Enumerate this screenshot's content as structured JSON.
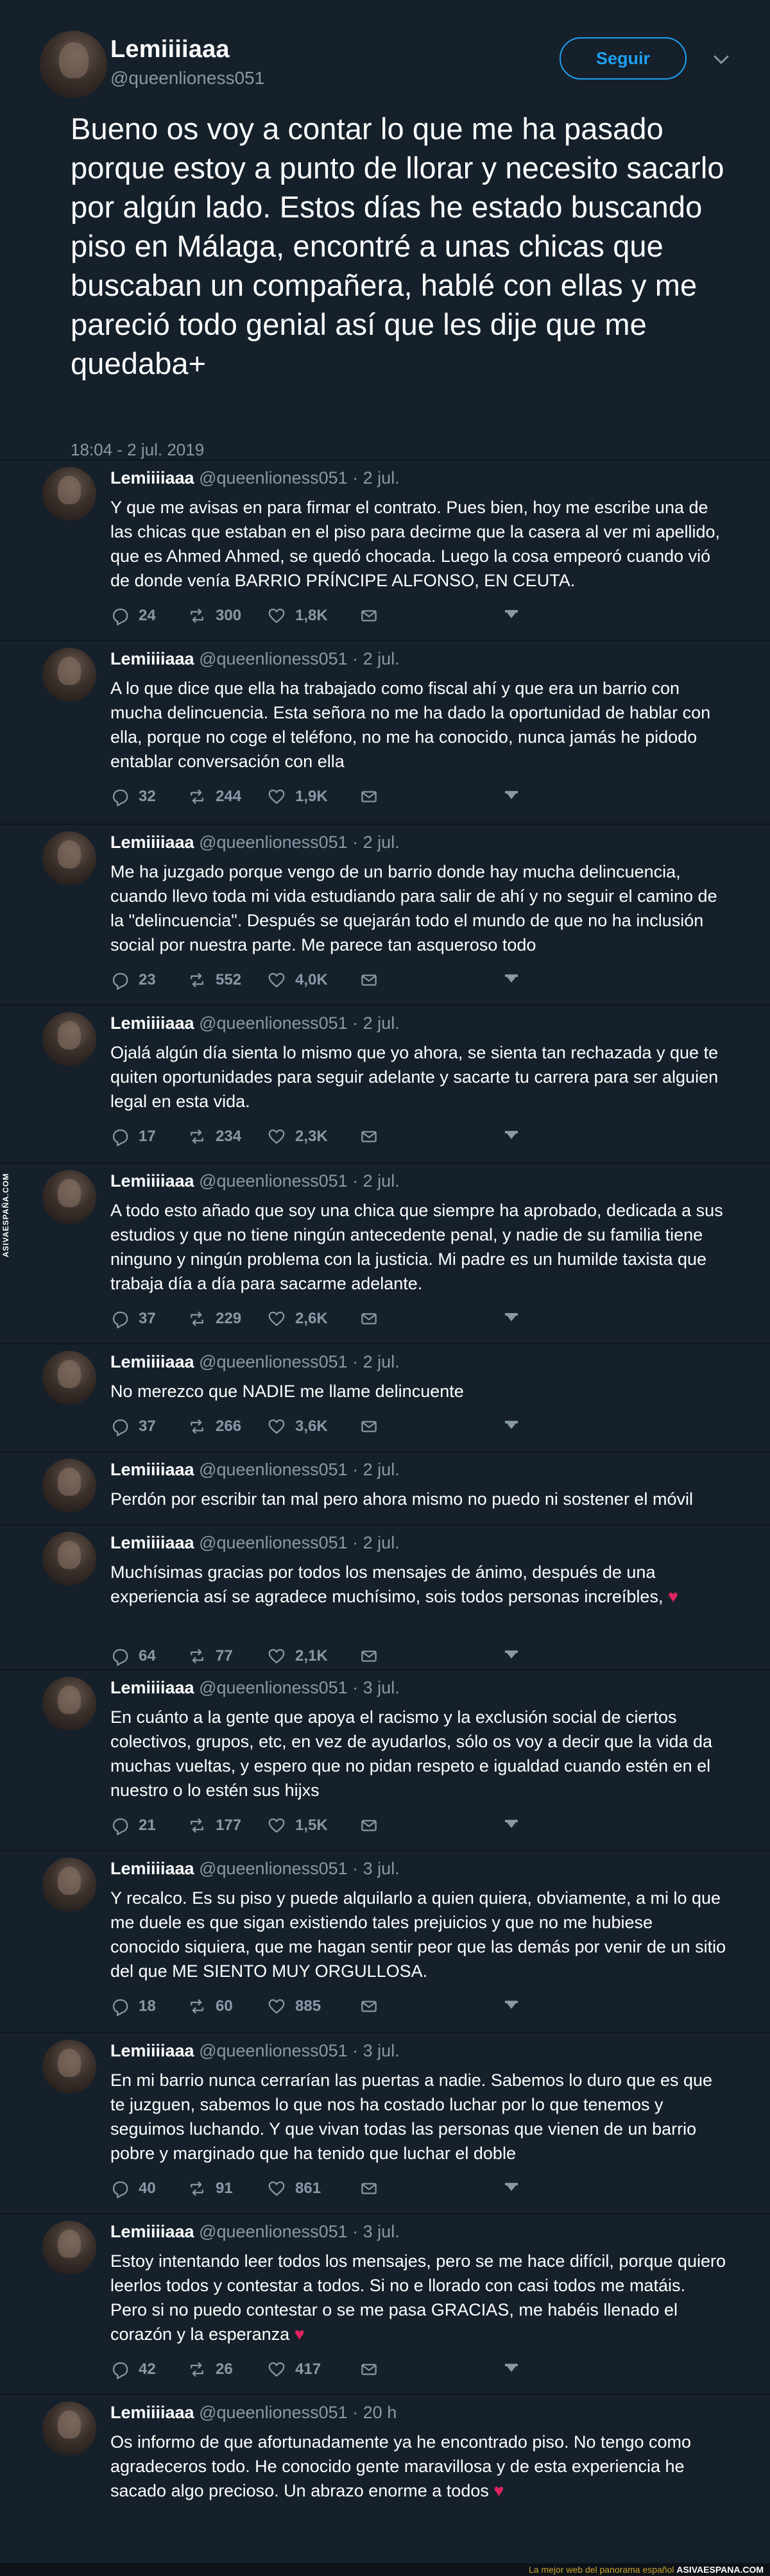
{
  "main": {
    "name": "Lemiiiiaaa",
    "handle": "@queenlioness051",
    "follow_label": "Seguir",
    "text": "Bueno os voy a contar lo que me ha pasado porque estoy a punto de llorar y necesito sacarlo por algún lado. Estos días he estado buscando piso en Málaga, encontré a unas chicas que buscaban un compañera, hablé con ellas y me pareció todo genial así que les dije que me quedaba+",
    "timestamp": "18:04 - 2 jul. 2019"
  },
  "replies": [
    {
      "name": "Lemiiiiaaa",
      "meta": " @queenlioness051 · 2 jul.",
      "text": "Y que me avisas en para firmar el contrato. Pues bien, hoy me escribe una de las chicas que estaban en el piso para decirme que la casera al ver mi apellido, que es Ahmed Ahmed, se quedó chocada. Luego la cosa empeoró cuando vió de donde venía BARRIO PRÍNCIPE ALFONSO, EN CEUTA.",
      "replies": "24",
      "retweets": "300",
      "likes": "1,8K"
    },
    {
      "name": "Lemiiiiaaa",
      "meta": " @queenlioness051 · 2 jul.",
      "text": "A lo que dice que ella ha trabajado como fiscal ahí y que era un barrio con mucha delincuencia. Esta señora no me ha dado la oportunidad de hablar con ella, porque no coge el teléfono, no me ha conocido, nunca jamás he pidodo entablar conversación con ella",
      "replies": "32",
      "retweets": "244",
      "likes": "1,9K"
    },
    {
      "name": "Lemiiiiaaa",
      "meta": " @queenlioness051 · 2 jul.",
      "text": "Me ha juzgado porque vengo de un barrio donde hay mucha delincuencia, cuando llevo toda mi vida estudiando para salir de ahí y no seguir el camino de la \"delincuencia\". Después se quejarán todo el mundo de que no ha inclusión social por nuestra parte. Me parece tan asqueroso todo",
      "replies": "23",
      "retweets": "552",
      "likes": "4,0K"
    },
    {
      "name": "Lemiiiiaaa",
      "meta": " @queenlioness051 · 2 jul.",
      "text": "Ojalá algún día sienta lo mismo que yo ahora, se sienta tan rechazada y que te quiten oportunidades para seguir adelante y sacarte tu carrera para ser alguien legal en esta vida.",
      "replies": "17",
      "retweets": "234",
      "likes": "2,3K"
    },
    {
      "name": "Lemiiiiaaa",
      "meta": " @queenlioness051 · 2 jul.",
      "text": "A todo esto añado que soy una chica que siempre ha aprobado, dedicada a sus estudios y que no tiene ningún antecedente penal, y nadie de su familia tiene ninguno y ningún problema con la justicia. Mi padre es un humilde taxista que trabaja día a día para sacarme adelante.",
      "replies": "37",
      "retweets": "229",
      "likes": "2,6K"
    },
    {
      "name": "Lemiiiiaaa",
      "meta": " @queenlioness051 · 2 jul.",
      "text": "No merezco que NADIE me llame delincuente",
      "replies": "37",
      "retweets": "266",
      "likes": "3,6K"
    },
    {
      "name": "Lemiiiiaaa",
      "meta": " @queenlioness051 · 2 jul.",
      "text": "Perdón por escribir tan mal pero ahora mismo no puedo ni sostener el móvil",
      "replies": "",
      "retweets": "",
      "likes": ""
    },
    {
      "name": "Lemiiiiaaa",
      "meta": " @queenlioness051 · 2 jul.",
      "text": "Muchísimas gracias por todos los mensajes de ánimo, después de una experiencia así se agradece muchísimo, sois todos personas increíbles, ",
      "heart": "♥",
      "replies": "64",
      "retweets": "77",
      "likes": "2,1K"
    },
    {
      "name": "Lemiiiiaaa",
      "meta": " @queenlioness051 · 3 jul.",
      "text": "En cuánto a la gente que apoya el racismo y la exclusión social de ciertos colectivos, grupos, etc, en vez de ayudarlos, sólo os voy a decir que la vida da muchas vueltas, y espero que no pidan respeto e igualdad cuando estén en el nuestro o lo estén sus hijxs",
      "replies": "21",
      "retweets": "177",
      "likes": "1,5K"
    },
    {
      "name": "Lemiiiiaaa",
      "meta": " @queenlioness051 · 3 jul.",
      "text": "Y recalco. Es su piso y puede alquilarlo a quien quiera, obviamente, a mi lo que me duele es que sigan existiendo tales prejuicios y que no me hubiese conocido siquiera, que me hagan sentir peor que las demás por venir de un sitio del que ME SIENTO MUY ORGULLOSA.",
      "replies": "18",
      "retweets": "60",
      "likes": "885"
    },
    {
      "name": "Lemiiiiaaa",
      "meta": " @queenlioness051 · 3 jul.",
      "text": "En mi barrio nunca cerrarían las puertas a nadie. Sabemos lo duro que es que te juzguen, sabemos lo que nos ha costado luchar por lo que tenemos y seguimos luchando. Y que vivan todas las personas que vienen de un barrio pobre y marginado que ha tenido que luchar el doble",
      "replies": "40",
      "retweets": "91",
      "likes": "861"
    },
    {
      "name": "Lemiiiiaaa",
      "meta": " @queenlioness051 · 3 jul.",
      "text": "Estoy intentando leer todos los mensajes, pero se me hace difícil, porque quiero leerlos todos y contestar a todos. Si no e llorado con casi todos me matáis. Pero si no puedo contestar o se me pasa GRACIAS, me habéis llenado el corazón y la esperanza ",
      "heart": "♥",
      "replies": "42",
      "retweets": "26",
      "likes": "417"
    },
    {
      "name": "Lemiiiiaaa",
      "meta": " @queenlioness051 · 20 h",
      "text": "Os informo de que afortunadamente ya he encontrado piso. No tengo como agradeceros todo. He conocido gente maravillosa y de esta experiencia he sacado algo precioso. Un abrazo enorme a todos ",
      "heart": "♥",
      "replies": "",
      "retweets": "",
      "likes": ""
    }
  ],
  "watermark": {
    "side": "ASIVAESPAÑA.COM",
    "footer_muted": "La mejor web del panorama español ",
    "footer_brand": "ASIVAESPANA.COM"
  },
  "colors": {
    "background": "#15202b",
    "accent": "#1da1f2",
    "muted": "#8899a6",
    "heart": "#e0245e"
  },
  "icons": [
    "reply-icon",
    "retweet-icon",
    "like-icon",
    "dm-icon",
    "more-icon",
    "chevron-down-icon"
  ]
}
